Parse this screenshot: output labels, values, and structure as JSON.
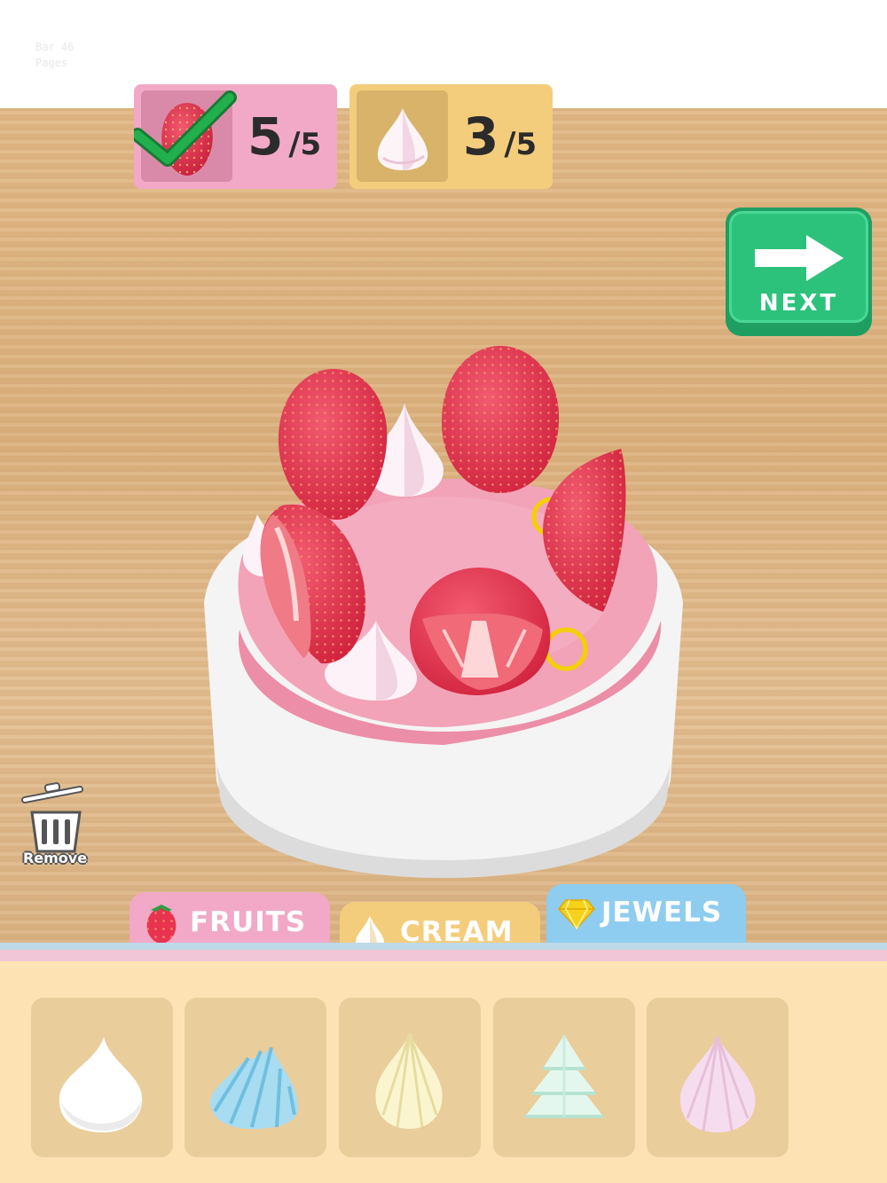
{
  "debug": {
    "line1": "Bar 46",
    "line2": "Pages"
  },
  "progress": {
    "fruits": {
      "icon": "strawberry-icon",
      "count": "5",
      "sep": "/",
      "total": "5",
      "completed": true
    },
    "cream": {
      "icon": "cream-dollop-icon",
      "count": "3",
      "sep": "/",
      "total": "5",
      "completed": false
    }
  },
  "next_button": {
    "label": "NEXT",
    "icon": "arrow-right-icon"
  },
  "remove_button": {
    "label": "Remove",
    "icon": "trash-can-icon"
  },
  "tabs": [
    {
      "id": "fruits",
      "label": "FRUITS",
      "icon": "strawberry-icon",
      "color": "#f1a9c7"
    },
    {
      "id": "cream",
      "label": "CREAM",
      "icon": "cream-dollop-icon",
      "color": "#f4cd7c",
      "active": true
    },
    {
      "id": "jewels",
      "label": "JEWELS",
      "icon": "gem-icon",
      "color": "#8ecdf0"
    }
  ],
  "cream_items": [
    {
      "name": "white-dollop",
      "color": "#ffffff"
    },
    {
      "name": "blue-swirl",
      "color": "#a8dcf0"
    },
    {
      "name": "yellow-swirl",
      "color": "#fbf5cf"
    },
    {
      "name": "mint-tree",
      "color": "#d9f4ea"
    },
    {
      "name": "pink-swirl",
      "color": "#f6dcef"
    }
  ],
  "colors": {
    "table": "#e2b987",
    "cake_pink": "#f2a3b8",
    "plate": "#ffffff",
    "strawberry": "#e8344f",
    "next_green": "#2cc27b",
    "check_green": "#1ca34a",
    "ring_yellow": "#f5d000"
  }
}
